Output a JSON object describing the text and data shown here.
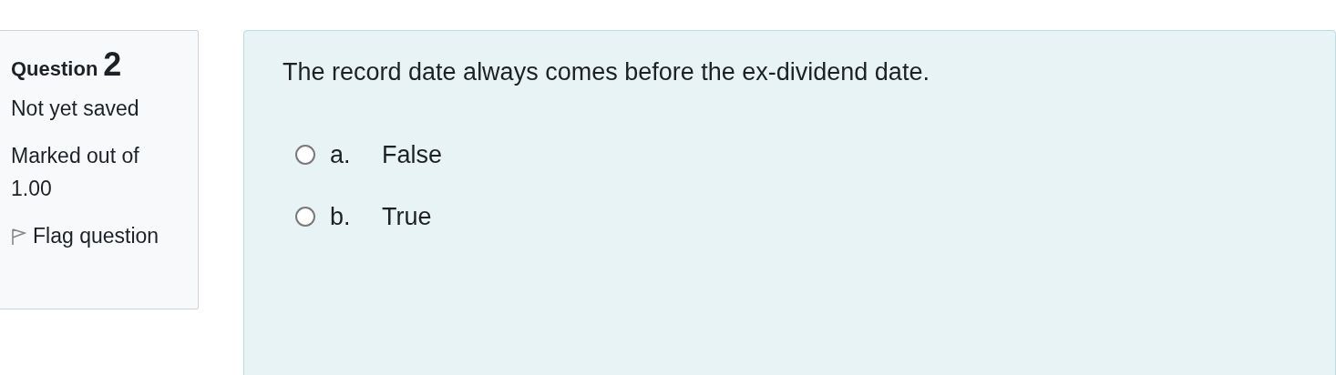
{
  "info": {
    "label": "Question",
    "number": "2",
    "state": "Not yet saved",
    "grade": "Marked out of 1.00",
    "flag": "Flag question"
  },
  "question": {
    "text": "The record date always comes before the ex-dividend date.",
    "options": [
      {
        "letter": "a.",
        "label": "False",
        "selected": false
      },
      {
        "letter": "b.",
        "label": "True",
        "selected": false
      }
    ]
  }
}
